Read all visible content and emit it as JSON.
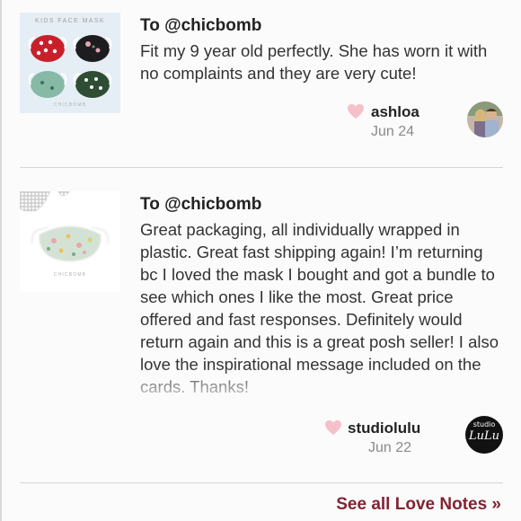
{
  "notes": [
    {
      "recipient": "To @chicbomb",
      "text": "Fit my 9 year old perfectly. She has worn it with no complaints and they are very cute!",
      "author": "ashloa",
      "date": "Jun 24",
      "thumbnail_title": "KIDS FACE MASK",
      "thumbnail_brand": "CHICBOMB"
    },
    {
      "recipient": "To @chicbomb",
      "text": "Great packaging, all individually wrapped in plastic. Great fast shipping again! I’m returning bc I loved the mask I bought and got a bundle to see which ones I like the most. Great price offered and fast responses. Definitely would return again and this is a great posh seller! I also love the inspirational message included on the cards. Thanks!",
      "author": "studiolulu",
      "date": "Jun 22",
      "thumbnail_brand": "CHICBOMB",
      "avatar_top": "studio",
      "avatar_script": "LuLu"
    }
  ],
  "see_all_label": "See all Love Notes »",
  "colors": {
    "heart": "#f6c0cb",
    "link": "#822432",
    "muted": "#8a8a8a",
    "divider": "#d6d6d6"
  },
  "icons": {
    "heart": "heart-icon"
  }
}
